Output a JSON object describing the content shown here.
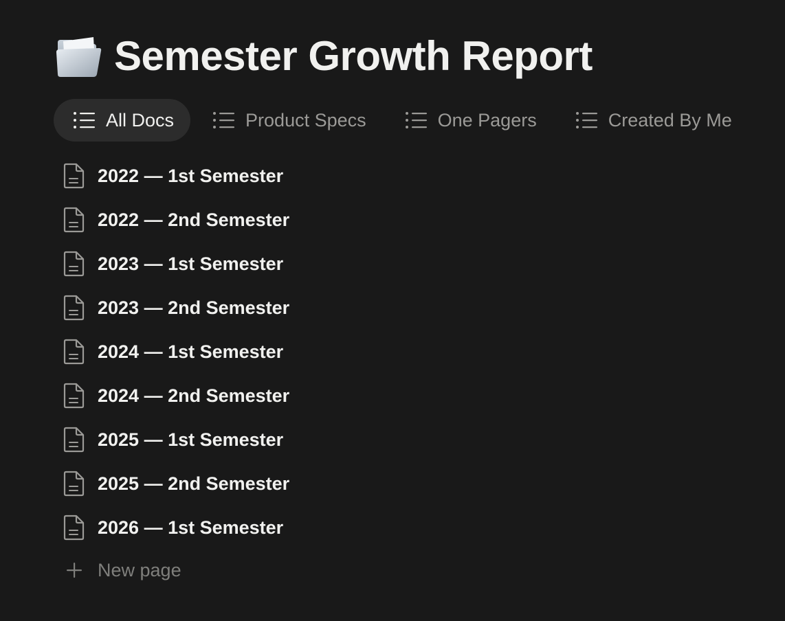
{
  "page": {
    "icon": "folder-icon",
    "title": "Semester Growth Report"
  },
  "tabs": [
    {
      "label": "All Docs",
      "icon": "list-icon",
      "active": true
    },
    {
      "label": "Product Specs",
      "icon": "list-icon",
      "active": false
    },
    {
      "label": "One Pagers",
      "icon": "list-icon",
      "active": false
    },
    {
      "label": "Created By Me",
      "icon": "list-icon",
      "active": false
    }
  ],
  "docs": [
    {
      "title": "2022 — 1st Semester",
      "icon": "document-icon"
    },
    {
      "title": "2022 — 2nd Semester",
      "icon": "document-icon"
    },
    {
      "title": "2023 — 1st Semester",
      "icon": "document-icon"
    },
    {
      "title": "2023 — 2nd Semester",
      "icon": "document-icon"
    },
    {
      "title": "2024 — 1st Semester",
      "icon": "document-icon"
    },
    {
      "title": "2024 — 2nd Semester",
      "icon": "document-icon"
    },
    {
      "title": "2025 — 1st Semester",
      "icon": "document-icon"
    },
    {
      "title": "2025 — 2nd Semester",
      "icon": "document-icon"
    },
    {
      "title": "2026 — 1st Semester",
      "icon": "document-icon"
    }
  ],
  "new_page": {
    "label": "New page",
    "icon": "plus-icon"
  },
  "colors": {
    "background": "#191919",
    "text_primary": "#f1f1ef",
    "text_secondary": "#9b9a97",
    "active_tab_bg": "#2c2c2c"
  }
}
